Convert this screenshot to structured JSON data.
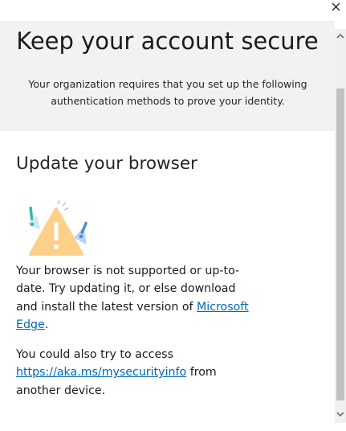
{
  "window": {
    "close_label": "✕"
  },
  "header": {
    "title": "Keep your account secure",
    "subtitle": "Your organization requires that you set up the following authentication methods to prove your identity."
  },
  "main": {
    "section_title": "Update your browser",
    "illustration_icon": "browser-warning-icon",
    "paragraph1": {
      "text_before": "Your browser is not supported or up-to-date. Try updating it, or else download and install the latest version of ",
      "link_label": "Microsoft Edge",
      "text_after": "."
    },
    "paragraph2": {
      "text_before": "You could also try to access ",
      "link_label": "https://aka.ms/mysecurityinfo",
      "text_after": " from another device."
    }
  },
  "colors": {
    "link": "#0067b8",
    "header_bg": "#f2f2f2",
    "warning_triangle": "#fdd08a",
    "accent_blue": "#4f8fdc",
    "accent_teal": "#3ab7b0"
  }
}
